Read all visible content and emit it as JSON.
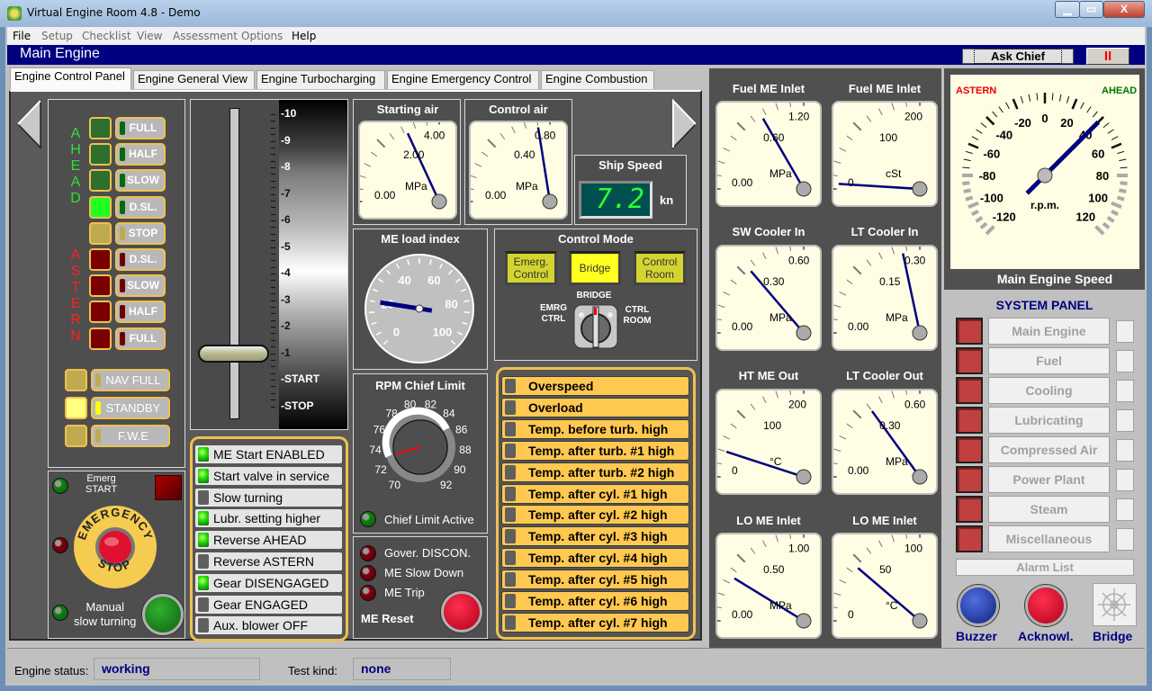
{
  "window": {
    "title": "Virtual Engine Room 4.8 - Demo",
    "min_glyph": "▁",
    "max_glyph": "▭",
    "close_glyph": "X"
  },
  "menu": [
    "File",
    "Setup",
    "Checklist",
    "View",
    "Assessment",
    "Options",
    "Help"
  ],
  "header": {
    "title": "Main Engine",
    "ask_chief": "Ask Chief",
    "pause_glyph": "II"
  },
  "tabs": [
    "Engine Control Panel",
    "Engine General View",
    "Engine Turbocharging",
    "Engine Emergency Control",
    "Engine Combustion"
  ],
  "telegraph": {
    "ahead_letters": [
      "A",
      "H",
      "E",
      "A",
      "D"
    ],
    "astern_letters": [
      "A",
      "S",
      "T",
      "E",
      "R",
      "N"
    ],
    "orders": [
      {
        "label": "FULL",
        "state": "ahead",
        "active": false
      },
      {
        "label": "HALF",
        "state": "ahead",
        "active": false
      },
      {
        "label": "SLOW",
        "state": "ahead",
        "active": false
      },
      {
        "label": "D.SL.",
        "state": "ahead",
        "active": true
      },
      {
        "label": "STOP",
        "state": "stop",
        "active": false
      },
      {
        "label": "D.SL.",
        "state": "astern",
        "active": false
      },
      {
        "label": "SLOW",
        "state": "astern",
        "active": false
      },
      {
        "label": "HALF",
        "state": "astern",
        "active": false
      },
      {
        "label": "FULL",
        "state": "astern",
        "active": false
      }
    ],
    "modes": [
      {
        "label": "NAV FULL",
        "active": false
      },
      {
        "label": "STANDBY",
        "active": true
      },
      {
        "label": "F.W.E",
        "active": false
      }
    ]
  },
  "lever": {
    "scale": [
      "10",
      "9",
      "8",
      "7",
      "6",
      "5",
      "4",
      "3",
      "2",
      "1",
      "START",
      "STOP"
    ],
    "position": 1
  },
  "emergency": {
    "emerg_start": "Emerg\nSTART",
    "emergency_text": "EMERGENCY",
    "stop_text": "STOP",
    "manual_slow_turning": "Manual\nslow turning"
  },
  "status_list": [
    {
      "label": "ME Start ENABLED",
      "on": true
    },
    {
      "label": "Start valve in service",
      "on": true
    },
    {
      "label": "Slow turning",
      "on": false
    },
    {
      "label": "Lubr. setting higher",
      "on": true
    },
    {
      "label": "Reverse AHEAD",
      "on": true
    },
    {
      "label": "Reverse ASTERN",
      "on": false
    },
    {
      "label": "Gear DISENGAGED",
      "on": true
    },
    {
      "label": "Gear ENGAGED",
      "on": false
    },
    {
      "label": "Aux. blower OFF",
      "on": false
    }
  ],
  "small_gauges": [
    {
      "title": "Starting air",
      "unit": "MPa",
      "labels": [
        "0.00",
        "2.00",
        "4.00"
      ],
      "max": 4.0,
      "value": 2.9
    },
    {
      "title": "Control air",
      "unit": "MPa",
      "labels": [
        "0.00",
        "0.40",
        "0.80"
      ],
      "max": 0.8,
      "value": 0.72
    }
  ],
  "ship_speed": {
    "title": "Ship Speed",
    "value": "7.2",
    "unit": "kn"
  },
  "load_index": {
    "title": "ME load index",
    "labels": [
      "0",
      "20",
      "40",
      "60",
      "80",
      "100"
    ],
    "value": 20
  },
  "control_mode": {
    "title": "Control Mode",
    "buttons": [
      {
        "label": "Emerg.\nControl",
        "active": false
      },
      {
        "label": "Bridge",
        "active": true
      },
      {
        "label": "Control\nRoom",
        "active": false
      }
    ],
    "switch_labels": {
      "top": "BRIDGE",
      "left": "EMRG\nCTRL",
      "right": "CTRL\nROOM"
    }
  },
  "rpm_chief_limit": {
    "title": "RPM Chief Limit",
    "labels": [
      "70",
      "72",
      "74",
      "76",
      "78",
      "80",
      "82",
      "84",
      "86",
      "88",
      "90",
      "92"
    ],
    "value": 73,
    "indicator": "Chief Limit Active"
  },
  "trips": {
    "items": [
      "Gover. DISCON.",
      "ME Slow Down",
      "ME Trip"
    ],
    "reset_label": "ME Reset"
  },
  "alarms": [
    "Overspeed",
    "Overload",
    "Temp. before turb. high",
    "Temp. after turb. #1 high",
    "Temp. after turb. #2 high",
    "Temp. after cyl. #1 high",
    "Temp. after cyl. #2 high",
    "Temp. after cyl. #3 high",
    "Temp. after cyl. #4 high",
    "Temp. after cyl. #5 high",
    "Temp. after cyl. #6 high",
    "Temp. after cyl. #7 high"
  ],
  "gauges": [
    {
      "title": "Fuel ME Inlet",
      "unit": "MPa",
      "labels": [
        "0.00",
        "0.60",
        "1.20"
      ],
      "max": 1.2,
      "value": 0.8
    },
    {
      "title": "Fuel ME Inlet",
      "unit": "cSt",
      "labels": [
        "0",
        "100",
        "200"
      ],
      "max": 200,
      "value": 8
    },
    {
      "title": "SW Cooler In",
      "unit": "MPa",
      "labels": [
        "0.00",
        "0.30",
        "0.60"
      ],
      "max": 0.6,
      "value": 0.33
    },
    {
      "title": "LT Cooler In",
      "unit": "MPa",
      "labels": [
        "0.00",
        "0.15",
        "0.30"
      ],
      "max": 0.3,
      "value": 0.26
    },
    {
      "title": "HT ME Out",
      "unit": "°C",
      "labels": [
        "0",
        "100",
        "200"
      ],
      "max": 200,
      "value": 40
    },
    {
      "title": "LT Cooler Out",
      "unit": "MPa",
      "labels": [
        "0.00",
        "0.30",
        "0.60"
      ],
      "max": 0.6,
      "value": 0.36
    },
    {
      "title": "LO ME Inlet",
      "unit": "MPa",
      "labels": [
        "0.00",
        "0.50",
        "1.00"
      ],
      "max": 1.0,
      "value": 0.35
    },
    {
      "title": "LO ME Inlet",
      "unit": "°C",
      "labels": [
        "0",
        "50",
        "100"
      ],
      "max": 100,
      "value": 45
    }
  ],
  "engine_speed": {
    "title": "Main Engine Speed",
    "astern": "ASTERN",
    "ahead": "AHEAD",
    "unit": "r.p.m.",
    "labels": [
      "-120",
      "-100",
      "-80",
      "-60",
      "-40",
      "-20",
      "0",
      "20",
      "40",
      "60",
      "80",
      "100",
      "120"
    ],
    "value": 40
  },
  "system_panel": {
    "title": "SYSTEM PANEL",
    "items": [
      "Main Engine",
      "Fuel",
      "Cooling",
      "Lubricating",
      "Compressed Air",
      "Power Plant",
      "Steam",
      "Miscellaneous"
    ],
    "alarm_list": "Alarm List",
    "buzzer": "Buzzer",
    "acknowledge": "Acknowl.",
    "bridge": "Bridge"
  },
  "statusbar": {
    "engine_status_label": "Engine status:",
    "engine_status": "working",
    "test_kind_label": "Test kind:",
    "test_kind": "none"
  }
}
